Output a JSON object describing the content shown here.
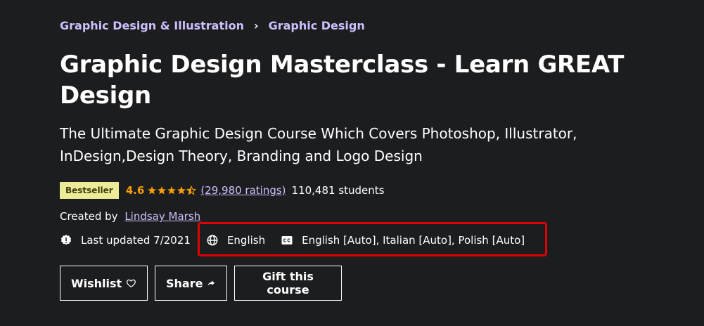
{
  "breadcrumb": {
    "items": [
      {
        "label": "Graphic Design & Illustration"
      },
      {
        "label": "Graphic Design"
      }
    ],
    "separator": "›"
  },
  "course": {
    "title": "Graphic Design Masterclass - Learn GREAT Design",
    "subtitle": "The Ultimate Graphic Design Course Which Covers Photoshop, Illustrator, InDesign,Design Theory, Branding and Logo Design",
    "badge": "Bestseller",
    "rating": "4.6",
    "rating_stars": 4.6,
    "ratings_count": "(29,980 ratings)",
    "students": "110,481 students",
    "created_by_label": "Created by",
    "instructor": "Lindsay Marsh",
    "last_updated": "Last updated 7/2021",
    "language": "English",
    "captions": "English [Auto], Italian [Auto], Polish [Auto]"
  },
  "actions": {
    "wishlist": "Wishlist",
    "share": "Share",
    "gift": "Gift this course"
  },
  "icons": {
    "update": "alert-badge-icon",
    "language": "globe-icon",
    "captions": "closed-captions-icon",
    "wishlist": "heart-icon",
    "share": "share-arrow-icon"
  },
  "colors": {
    "background": "#1c1d1f",
    "link": "#cec0fc",
    "star": "#f69c08",
    "badge_bg": "#eceb98",
    "badge_text": "#3d3c0a",
    "highlight": "#e00000"
  }
}
